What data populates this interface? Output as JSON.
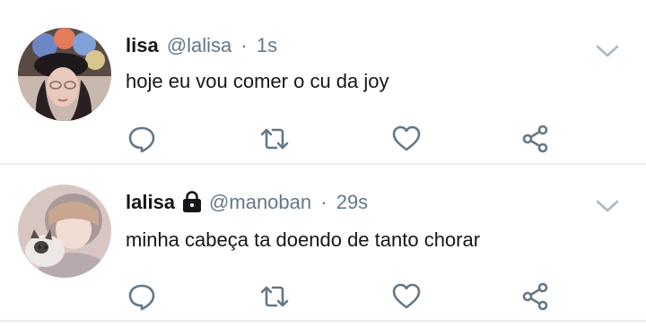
{
  "tweets": [
    {
      "display_name": "lisa",
      "handle": "@lalisa",
      "separator": "·",
      "time": "1s",
      "text": "hoje eu vou comer o cu da joy",
      "protected": false
    },
    {
      "display_name": "lalisa",
      "handle": "@manoban",
      "separator": "·",
      "time": "29s",
      "text": "minha cabeça ta doendo de tanto chorar",
      "protected": true
    }
  ],
  "icons": {
    "more": "chevron-down-icon",
    "reply": "reply-icon",
    "retweet": "retweet-icon",
    "like": "heart-icon",
    "share": "share-icon",
    "protected": "lock-icon"
  },
  "colors": {
    "text": "#14171a",
    "secondary": "#657786",
    "icon": "#657786",
    "divider": "#e6ecf0",
    "chevron": "#aab8c2"
  }
}
